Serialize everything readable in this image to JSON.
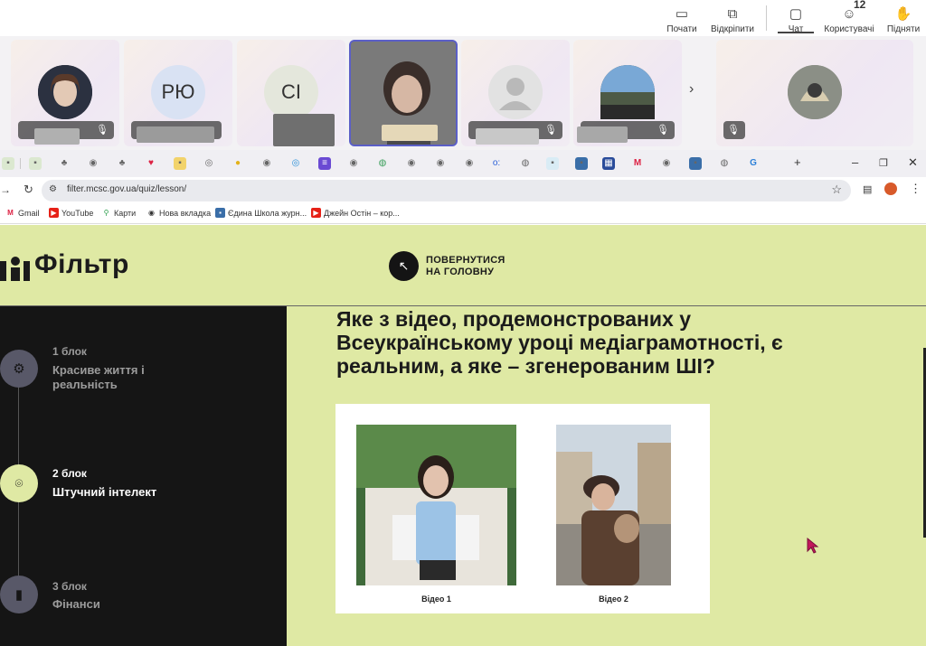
{
  "meeting": {
    "toolbar": {
      "share": {
        "label": "Почати",
        "icon": "share-screen-icon"
      },
      "detach": {
        "label": "Відкріпити",
        "icon": "pop-out-icon"
      },
      "chat": {
        "label": "Чат",
        "icon": "chat-icon"
      },
      "people": {
        "label": "Користувачі",
        "icon": "people-icon",
        "count": "12"
      },
      "raise": {
        "label": "Підняти",
        "icon": "raise-hand-icon"
      }
    },
    "participants": [
      {
        "initials": ""
      },
      {
        "initials": "РЮ"
      },
      {
        "initials": "СІ"
      },
      {
        "initials": ""
      },
      {
        "initials": ""
      },
      {
        "initials": ""
      },
      {
        "initials": ""
      }
    ]
  },
  "browser": {
    "url": "filter.mcsc.gov.ua/quiz/lesson/",
    "bookmarks": [
      {
        "label": "Gmail",
        "icon": "gmail-icon"
      },
      {
        "label": "YouTube",
        "icon": "youtube-icon"
      },
      {
        "label": "Карти",
        "icon": "maps-icon"
      },
      {
        "label": "Нова вкладка",
        "icon": "new-tab-icon"
      },
      {
        "label": "Єдина Школа журн...",
        "icon": "school-icon"
      },
      {
        "label": "Джейн Остін – кор...",
        "icon": "youtube-icon"
      }
    ]
  },
  "site": {
    "logo": "Фільтр",
    "back_line1": "ПОВЕРНУТИСЯ",
    "back_line2": "НА ГОЛОВНУ",
    "steps": [
      {
        "num": "1 блок",
        "title_line1": "Красиве життя і",
        "title_line2": "реальність",
        "icon": "gear-icon"
      },
      {
        "num": "2 блок",
        "title_line1": "Штучний інтелект",
        "title_line2": "",
        "icon": "ai-scan-icon"
      },
      {
        "num": "3 блок",
        "title_line1": "Фінанси",
        "title_line2": "",
        "icon": "phone-icon"
      }
    ],
    "question": "Яке з відео, продемонстрованих у Всеукраїнському уроці медіаграмотності, є реальним, а яке – згенерованим ШІ?",
    "videos": [
      {
        "caption": "Відео 1"
      },
      {
        "caption": "Відео 2"
      }
    ]
  },
  "colors": {
    "accent": "#dfe9a4",
    "sidebar": "#151515",
    "teams_accent": "#5b5fc7"
  }
}
